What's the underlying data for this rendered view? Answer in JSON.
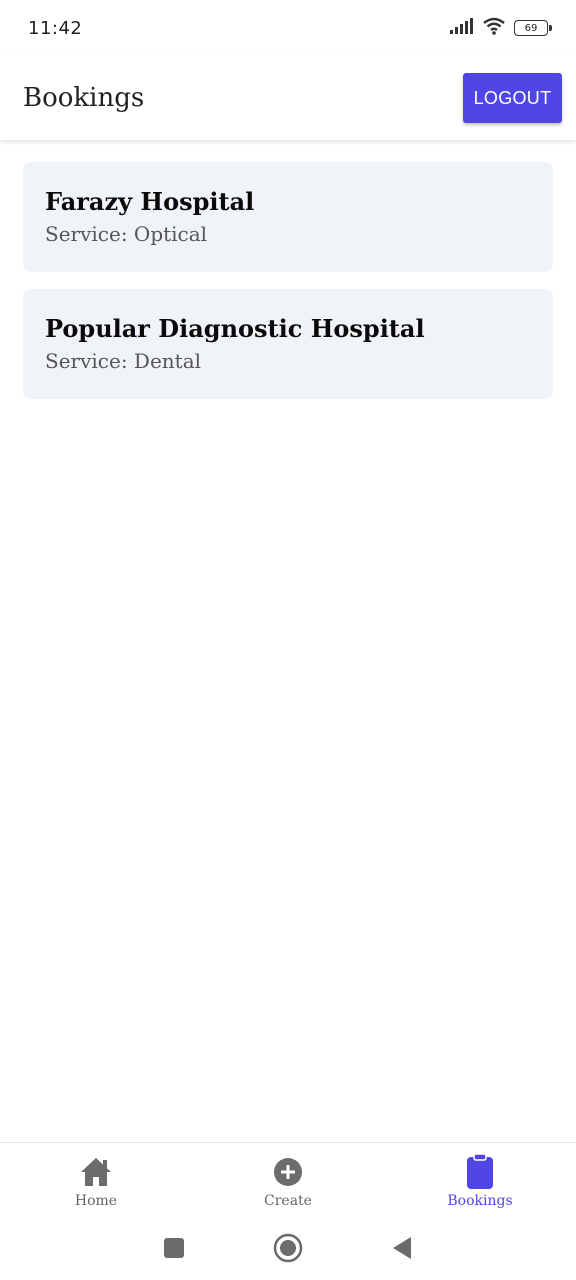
{
  "status_bar": {
    "time": "11:42",
    "battery": "69",
    "icons": [
      "signal-icon",
      "wifi-icon",
      "battery-icon"
    ]
  },
  "header": {
    "title": "Bookings",
    "logout_label": "LOGOUT",
    "accent_color": "#4f46e5"
  },
  "bookings": [
    {
      "hospital": "Farazy Hospital",
      "service": "Service: Optical"
    },
    {
      "hospital": "Popular Diagnostic Hospital",
      "service": "Service: Dental"
    }
  ],
  "bottom_nav": {
    "items": [
      {
        "label": "Home",
        "icon": "home-icon"
      },
      {
        "label": "Create",
        "icon": "plus-circle-icon"
      },
      {
        "label": "Bookings",
        "icon": "clipboard-icon",
        "active": true
      }
    ]
  },
  "system_nav": {
    "icons": [
      "recents-icon",
      "home-circle-icon",
      "back-icon"
    ]
  }
}
